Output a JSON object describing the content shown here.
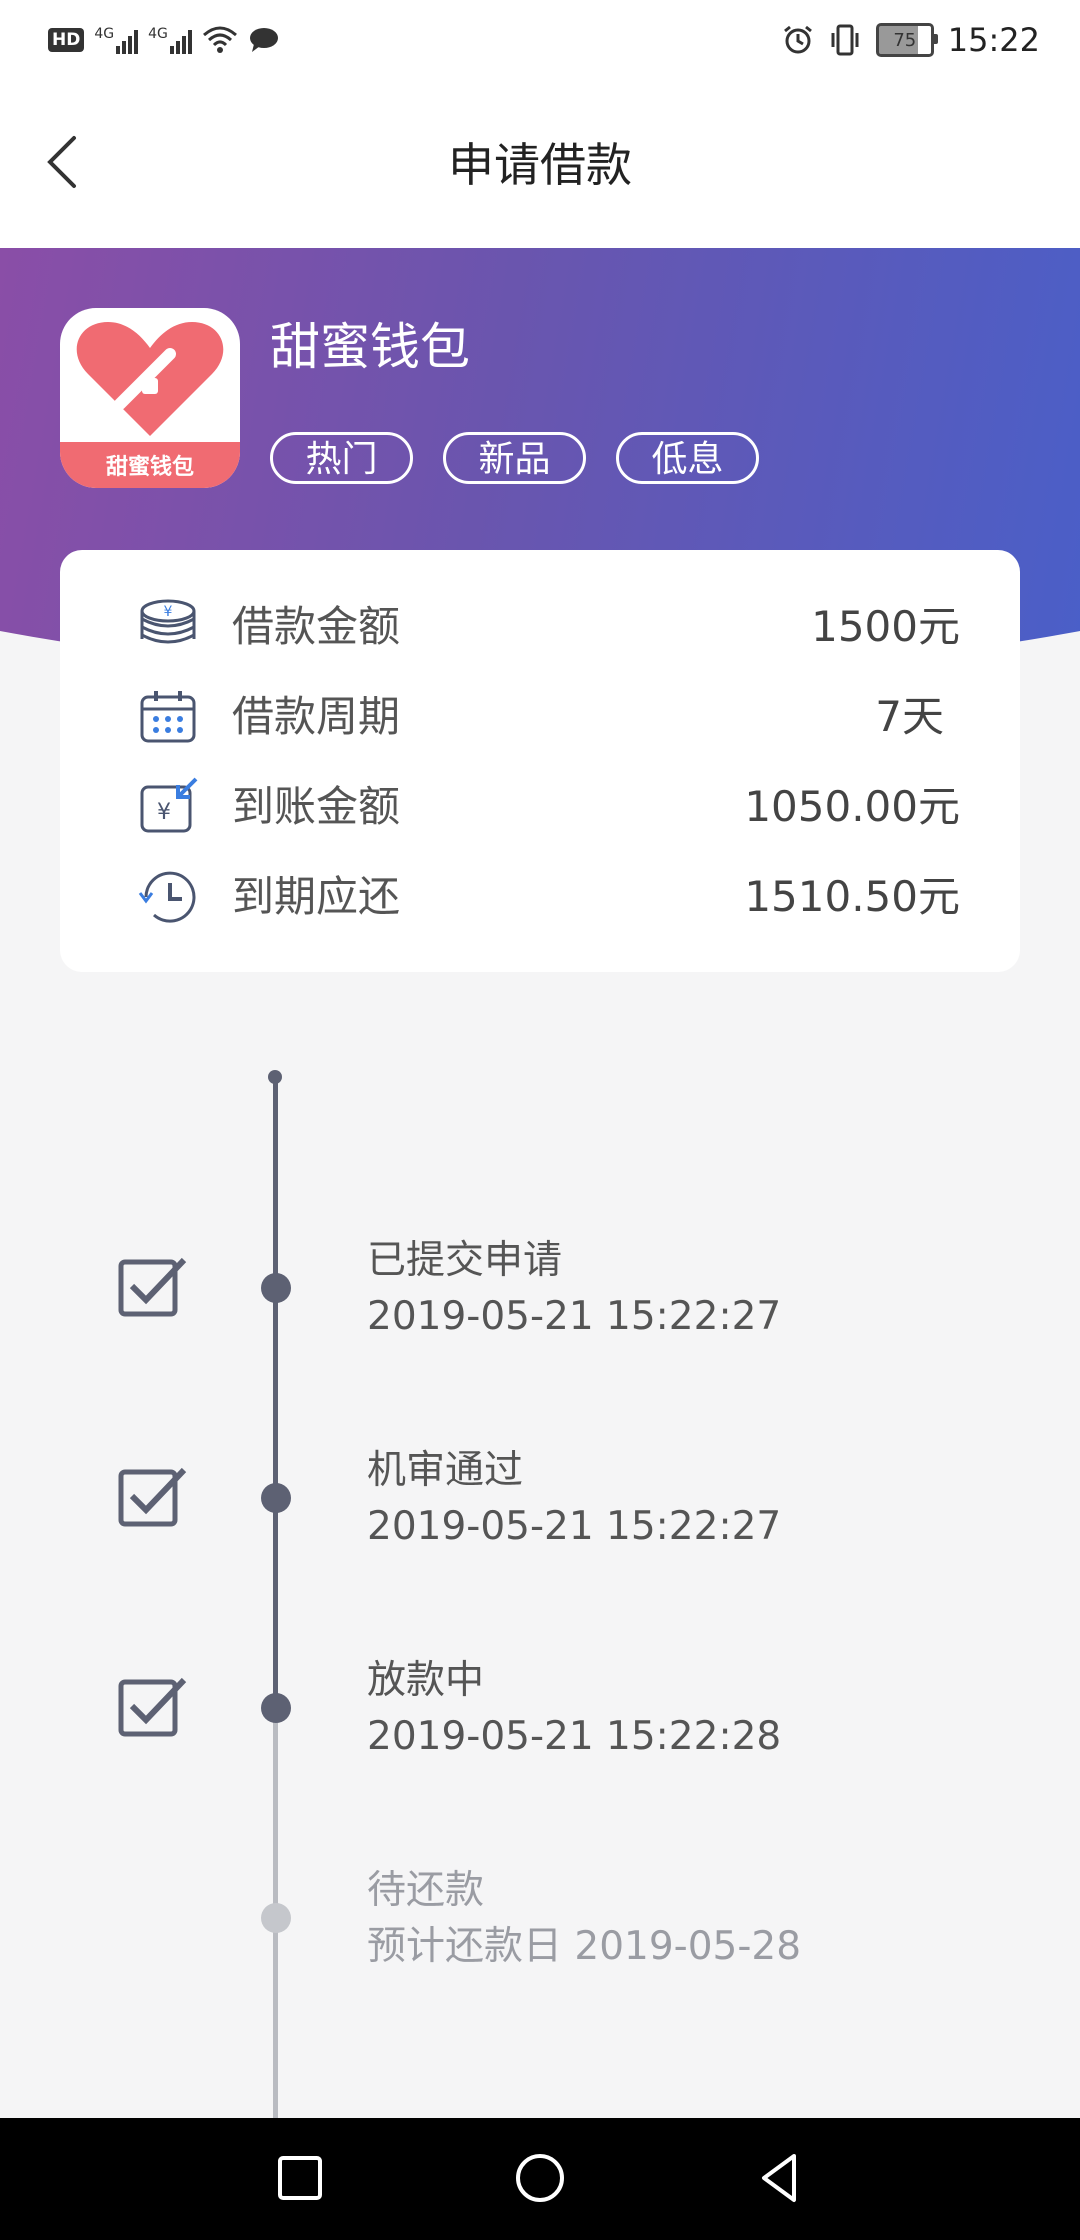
{
  "status_bar": {
    "hd_label": "HD",
    "signal1_label": "4G",
    "signal2_label": "4G",
    "battery_level": "75",
    "time": "15:22"
  },
  "header": {
    "title": "申请借款"
  },
  "app": {
    "name": "甜蜜钱包",
    "logo_text": "甜蜜钱包",
    "tags": [
      "热门",
      "新品",
      "低息"
    ]
  },
  "loan_info": [
    {
      "icon": "coins-yen-icon",
      "label": "借款金额",
      "value": "1500元"
    },
    {
      "icon": "calendar-icon",
      "label": "借款周期",
      "value": "7天"
    },
    {
      "icon": "yen-receive-icon",
      "label": "到账金额",
      "value": "1050.00元"
    },
    {
      "icon": "history-clock-icon",
      "label": "到期应还",
      "value": "1510.50元"
    }
  ],
  "timeline": [
    {
      "title": "已提交申请",
      "time": "2019-05-21 15:22:27",
      "done": true
    },
    {
      "title": "机审通过",
      "time": "2019-05-21 15:22:27",
      "done": true
    },
    {
      "title": "放款中",
      "time": "2019-05-21 15:22:28",
      "done": true
    },
    {
      "title": "待还款",
      "time": "预计还款日 2019-05-28",
      "done": false
    }
  ],
  "colors": {
    "banner_start": "#8a4ea7",
    "banner_end": "#4a5fc8",
    "timeline_active": "#5d6173",
    "timeline_pending": "#c5c7cc",
    "logo_accent": "#f06b72"
  }
}
